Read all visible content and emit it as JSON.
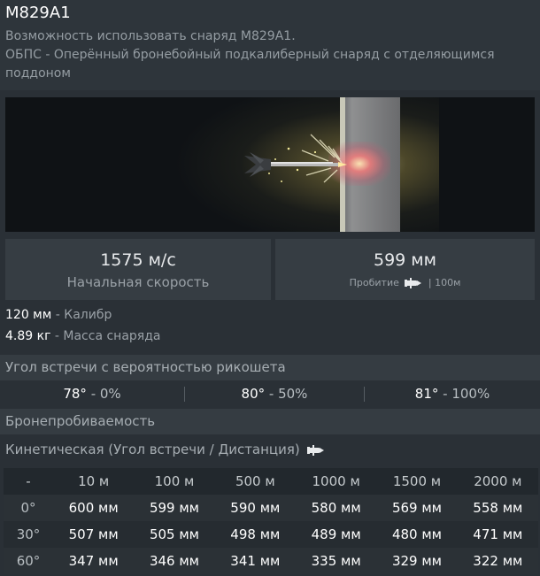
{
  "header": {
    "title": "M829A1",
    "line1": "Возможность использовать снаряд M829A1.",
    "line2": "ОБПС - Оперённый бронебойный подкалиберный снаряд с отделяющимся поддоном"
  },
  "stats": {
    "velocity_value": "1575 м/с",
    "velocity_label": "Начальная скорость",
    "penetration_value": "599 мм",
    "penetration_label": "Пробитие",
    "penetration_suffix": "| 100м"
  },
  "specs": {
    "caliber_value": "120 мм",
    "caliber_label": " - Калибр",
    "mass_value": "4.89 кг",
    "mass_label": " - Масса снаряда"
  },
  "ricochet": {
    "header": "Угол встречи с вероятностью рикошета",
    "cells": [
      {
        "angle": "78°",
        "prob": " - 0%"
      },
      {
        "angle": "80°",
        "prob": " - 50%"
      },
      {
        "angle": "81°",
        "prob": " - 100%"
      }
    ]
  },
  "armor": {
    "header": "Бронепробиваемость",
    "kinetic_label": "Кинетическая (Угол встречи / Дистанция)"
  },
  "table": {
    "columns": [
      "-",
      "10 м",
      "100 м",
      "500 м",
      "1000 м",
      "1500 м",
      "2000 м"
    ],
    "rows": [
      {
        "angle": "0°",
        "values": [
          "600 мм",
          "599 мм",
          "590 мм",
          "580 мм",
          "569 мм",
          "558 мм"
        ]
      },
      {
        "angle": "30°",
        "values": [
          "507 мм",
          "505 мм",
          "498 мм",
          "489 мм",
          "480 мм",
          "471 мм"
        ]
      },
      {
        "angle": "60°",
        "values": [
          "347 мм",
          "346 мм",
          "341 мм",
          "335 мм",
          "329 мм",
          "322 мм"
        ]
      }
    ]
  },
  "icons": {
    "shell": "shell-icon"
  },
  "colors": {
    "background": "#2a3036",
    "panel": "#363d43",
    "text": "#ffffff",
    "muted": "#9aa1a7"
  }
}
